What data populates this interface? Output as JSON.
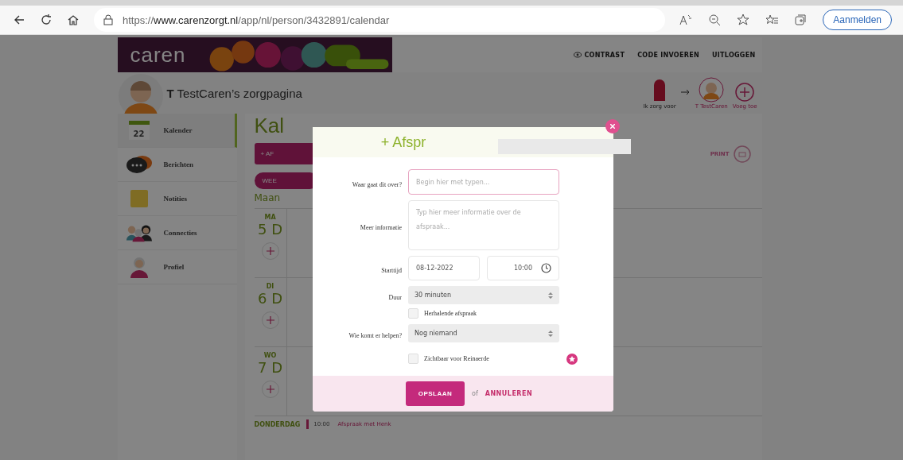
{
  "browser": {
    "url_scheme": "https://",
    "url_domain": "www.carenzorgt.nl",
    "url_path": "/app/nl/person/3432891/calendar",
    "signin": "Aanmelden"
  },
  "logo": "caren",
  "top_links": [
    {
      "label": "CONTRAST"
    },
    {
      "label": "CODE INVOEREN"
    },
    {
      "label": "UITLOGGEN"
    }
  ],
  "page_title": "**T** TestCaren’s zorgpagina",
  "care_nav": [
    {
      "label": "Ik zorg voor",
      "kind": "bag"
    },
    {
      "label": "T TestCaren",
      "kind": "avatar"
    },
    {
      "label": "Voeg toe",
      "kind": "add"
    }
  ],
  "sidebar": [
    {
      "label": "Kalender",
      "kind": "calendar",
      "badge": "22",
      "selected": true
    },
    {
      "label": "Berichten",
      "kind": "chat",
      "selected": false
    },
    {
      "label": "Notities",
      "kind": "note",
      "selected": false
    },
    {
      "label": "Connecties",
      "kind": "people",
      "selected": false
    },
    {
      "label": "Profiel",
      "kind": "person",
      "selected": false
    }
  ],
  "main": {
    "heading": "Kal",
    "add_button": "+ AF",
    "view_button": "WEE",
    "period": "Maan",
    "print": "PRINT",
    "days": [
      {
        "weekday": "MA",
        "date": "5 D"
      },
      {
        "weekday": "DI",
        "date": "6 D"
      },
      {
        "weekday": "WO",
        "date": "7 D"
      }
    ],
    "next_day": {
      "weekday": "DONDERDAG",
      "time": "10:00",
      "event": "Afspraak met Henk"
    }
  },
  "modal": {
    "title": "+ Afspr",
    "fields": [
      {
        "kind": "text",
        "label": "Waar gaat dit over?",
        "placeholder": "Begin hier met typen..."
      },
      {
        "kind": "textarea",
        "label": "Meer informatie",
        "placeholder": "Typ hier meer informatie over de afspraak..."
      },
      {
        "kind": "datetime",
        "label": "Starttijd",
        "date": "08-12-2022",
        "time": "10:00"
      },
      {
        "kind": "select",
        "label": "Duur",
        "value": "30 minuten"
      },
      {
        "kind": "checkbox",
        "label": "Herhalende afspraak",
        "checked": false
      },
      {
        "kind": "select",
        "label": "Wie komt er helpen?",
        "value": "Nog niemand"
      },
      {
        "kind": "checkbox",
        "label": "Zichtbaar voor Reinaerde",
        "checked": false,
        "info": true
      }
    ],
    "save": "OPSLAAN",
    "or": "of",
    "cancel": "ANNULEREN"
  }
}
